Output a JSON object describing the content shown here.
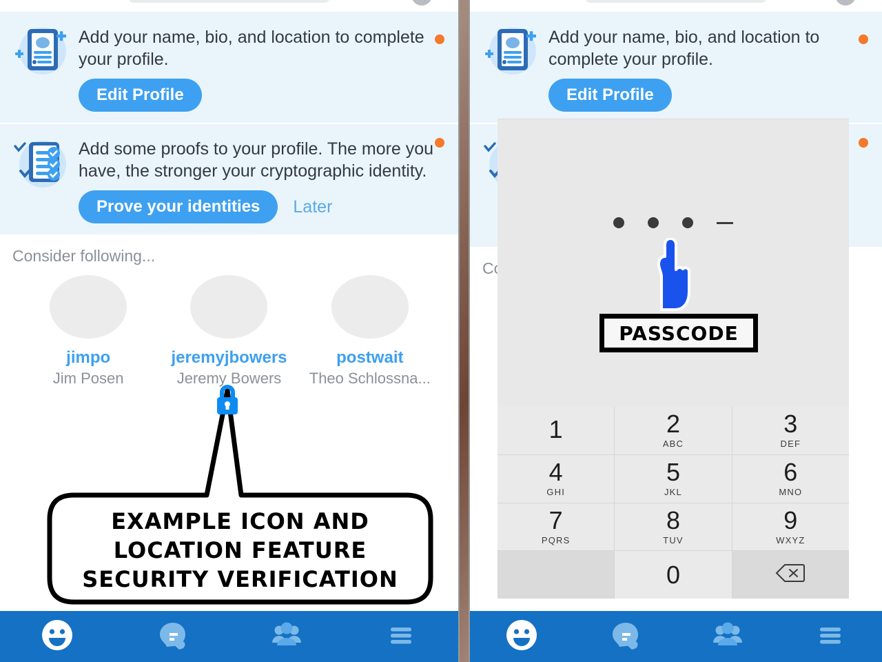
{
  "background": {
    "color": "#7d5243"
  },
  "colors": {
    "accent_blue": "#3ea0f0",
    "nav_blue": "#1471c4",
    "card_blue": "#e9f5fb",
    "badge_orange": "#f4792b",
    "muted_gray": "#8b9198",
    "annotation_blue": "#1a53ec"
  },
  "left_phone": {
    "cards": [
      {
        "icon": "profile-card-icon",
        "text": "Add your name, bio, and location to complete your profile.",
        "primary_button": "Edit Profile",
        "secondary_link": "",
        "badge": "unread-dot"
      },
      {
        "icon": "checklist-proofs-icon",
        "text": "Add some proofs to your profile. The more you have, the stronger your cryptographic identity.",
        "primary_button": "Prove your identities",
        "secondary_link": "Later",
        "badge": "unread-dot"
      }
    ],
    "suggestions": {
      "title": "Consider following...",
      "people": [
        {
          "username": "jimpo",
          "fullname": "Jim Posen"
        },
        {
          "username": "jeremyjbowers",
          "fullname": "Jeremy Bowers"
        },
        {
          "username": "postwait",
          "fullname": "Theo Schlossna..."
        }
      ]
    },
    "annotation": {
      "icon": "lock-icon",
      "lines": [
        "EXAMPLE ICON AND",
        "LOCATION FEATURE",
        "SECURITY VERIFICATION"
      ]
    }
  },
  "right_phone": {
    "cards": [
      {
        "icon": "profile-card-icon",
        "text": "Add your name, bio, and location to complete your profile.",
        "primary_button": "Edit Profile",
        "badge": "unread-dot"
      },
      {
        "icon": "checklist-proofs-icon",
        "text": "",
        "badge": "unread-dot"
      }
    ],
    "suggestions": {
      "title": "Consider following...",
      "truncated_text": "Co"
    },
    "passcode": {
      "entered_count": 3,
      "total_slots": 4,
      "dots": [
        "filled",
        "filled",
        "filled",
        "empty"
      ],
      "annotation_label": "PASSCODE",
      "cursor": "pointing-finger-cursor"
    },
    "keypad": {
      "keys": [
        {
          "digit": "1",
          "letters": ""
        },
        {
          "digit": "2",
          "letters": "ABC"
        },
        {
          "digit": "3",
          "letters": "DEF"
        },
        {
          "digit": "4",
          "letters": "GHI"
        },
        {
          "digit": "5",
          "letters": "JKL"
        },
        {
          "digit": "6",
          "letters": "MNO"
        },
        {
          "digit": "7",
          "letters": "PQRS"
        },
        {
          "digit": "8",
          "letters": "TUV"
        },
        {
          "digit": "9",
          "letters": "WXYZ"
        },
        {
          "digit": "",
          "letters": "",
          "type": "blank"
        },
        {
          "digit": "0",
          "letters": ""
        },
        {
          "digit": "",
          "letters": "",
          "type": "backspace"
        }
      ]
    }
  },
  "bottom_nav": {
    "items": [
      {
        "icon": "smiley-face-icon",
        "active": true
      },
      {
        "icon": "chat-bubbles-icon",
        "active": false
      },
      {
        "icon": "people-group-icon",
        "active": false
      },
      {
        "icon": "hamburger-menu-icon",
        "active": false
      }
    ]
  }
}
